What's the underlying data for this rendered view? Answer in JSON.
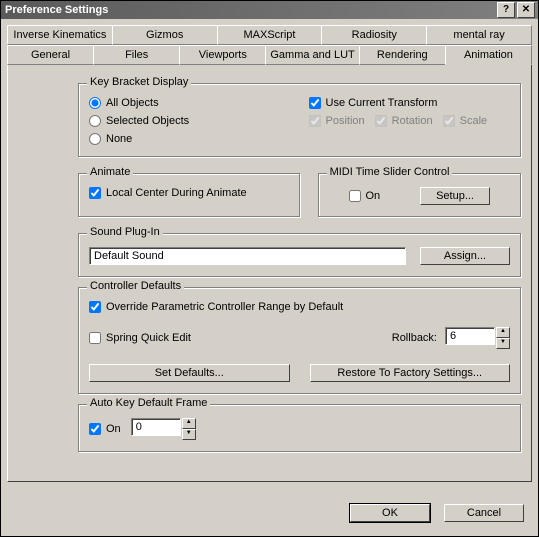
{
  "window": {
    "title": "Preference Settings"
  },
  "tabs_row1": [
    {
      "label": "Inverse Kinematics"
    },
    {
      "label": "Gizmos"
    },
    {
      "label": "MAXScript"
    },
    {
      "label": "Radiosity"
    },
    {
      "label": "mental ray"
    }
  ],
  "tabs_row2": [
    {
      "label": "General"
    },
    {
      "label": "Files"
    },
    {
      "label": "Viewports"
    },
    {
      "label": "Gamma and LUT"
    },
    {
      "label": "Rendering"
    },
    {
      "label": "Animation"
    }
  ],
  "groups": {
    "keyBracket": {
      "legend": "Key Bracket Display",
      "allObjects": "All Objects",
      "selectedObjects": "Selected Objects",
      "none": "None",
      "useCurrent": "Use Current Transform",
      "position": "Position",
      "rotation": "Rotation",
      "scale": "Scale"
    },
    "animate": {
      "legend": "Animate",
      "localCenter": "Local Center During Animate"
    },
    "midi": {
      "legend": "MIDI Time Slider Control",
      "on": "On",
      "setup": "Setup..."
    },
    "sound": {
      "legend": "Sound Plug-In",
      "value": "Default Sound",
      "assign": "Assign..."
    },
    "controller": {
      "legend": "Controller Defaults",
      "override": "Override Parametric Controller Range by Default",
      "spring": "Spring Quick Edit",
      "rollbackLabel": "Rollback:",
      "rollbackValue": "6",
      "setDefaults": "Set Defaults...",
      "restore": "Restore To Factory Settings..."
    },
    "autokey": {
      "legend": "Auto Key Default Frame",
      "on": "On",
      "value": "0"
    }
  },
  "buttons": {
    "ok": "OK",
    "cancel": "Cancel"
  }
}
